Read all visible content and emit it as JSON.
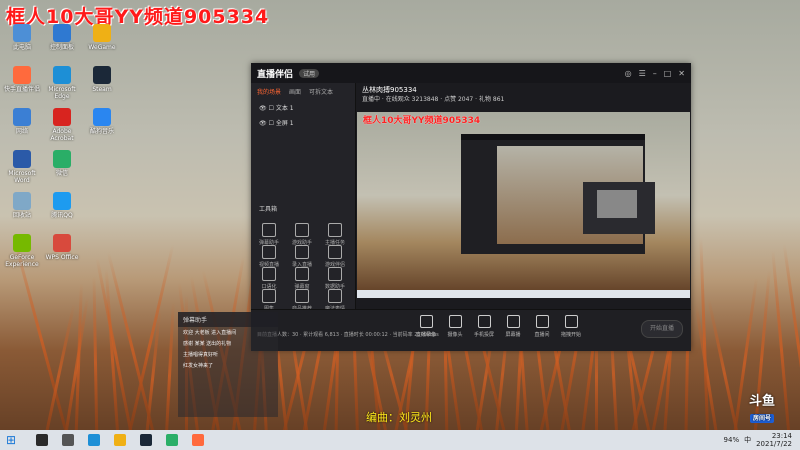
{
  "overlay_title": "框人10大哥YY频道905334",
  "desktop_icons": [
    {
      "label": "此电脑",
      "color": "#4d8fd6"
    },
    {
      "label": "快手直播伴侣",
      "color": "#ff6a3d"
    },
    {
      "label": "网络",
      "color": "#3b7fd4"
    },
    {
      "label": "Microsoft Word",
      "color": "#2b5aa8"
    },
    {
      "label": "回收站",
      "color": "#7fa8c7"
    },
    {
      "label": "GeForce Experience",
      "color": "#76b900"
    },
    {
      "label": "控制面板",
      "color": "#2f79d1"
    },
    {
      "label": "Microsoft Edge",
      "color": "#1d8fd6"
    },
    {
      "label": "Adobe Acrobat",
      "color": "#d8241f"
    },
    {
      "label": "微信",
      "color": "#2aae67"
    },
    {
      "label": "腾讯QQ",
      "color": "#1d9bf0"
    },
    {
      "label": "WPS Office",
      "color": "#d84a3d"
    },
    {
      "label": "WeGame",
      "color": "#efb015"
    },
    {
      "label": "Steam",
      "color": "#1b2838"
    },
    {
      "label": "酷狗音乐",
      "color": "#2a86f0"
    }
  ],
  "live_app": {
    "title": "直播伴侣",
    "tag": "试用",
    "tabs": [
      "我的场景",
      "画面",
      "可拆文本"
    ],
    "scenes": [
      "文本 1",
      "全屏 1"
    ],
    "tools_title": "工具箱",
    "tools": [
      "弹幕助手",
      "游戏助手",
      "主播任务",
      "视频直播",
      "录入直播",
      "游戏伴侣",
      "口语化",
      "弹幕窗",
      "数据助手",
      "图集",
      "商品推荐",
      "魔法表情"
    ],
    "room_title": "丛林肉搏905334",
    "room_meta": "直播中 · 在线观众 3213848 · 点赞 2047 · 礼物 861",
    "bottom": [
      "直播录像",
      "摄像头",
      "手机投屏",
      "屏幕播",
      "直播间",
      "拖拽开始"
    ],
    "start_label": "开始直播",
    "status": "目前直播人数：30 · 累计观看 6,813 · 直播时长 00:00:12 · 当前码率 2500kbps"
  },
  "chat": {
    "title": "弹幕助手",
    "lines": [
      "欢迎 大老板 进入直播间",
      "感谢 某某 送出的礼物",
      "主播唱得真好听",
      "红发女神来了"
    ]
  },
  "lyric": "编曲：刘灵州",
  "brand": {
    "name": "斗鱼",
    "sub": "房间号"
  },
  "taskbar": {
    "clock_time": "23:14",
    "clock_date": "2021/7/22",
    "tray_battery": "94%",
    "tray_lang": "中"
  },
  "colors": {
    "accent": "#ff6633",
    "overlay_red": "#ff1a1a",
    "lyric": "#ffea1a",
    "taskbar": "#dde2e8"
  }
}
